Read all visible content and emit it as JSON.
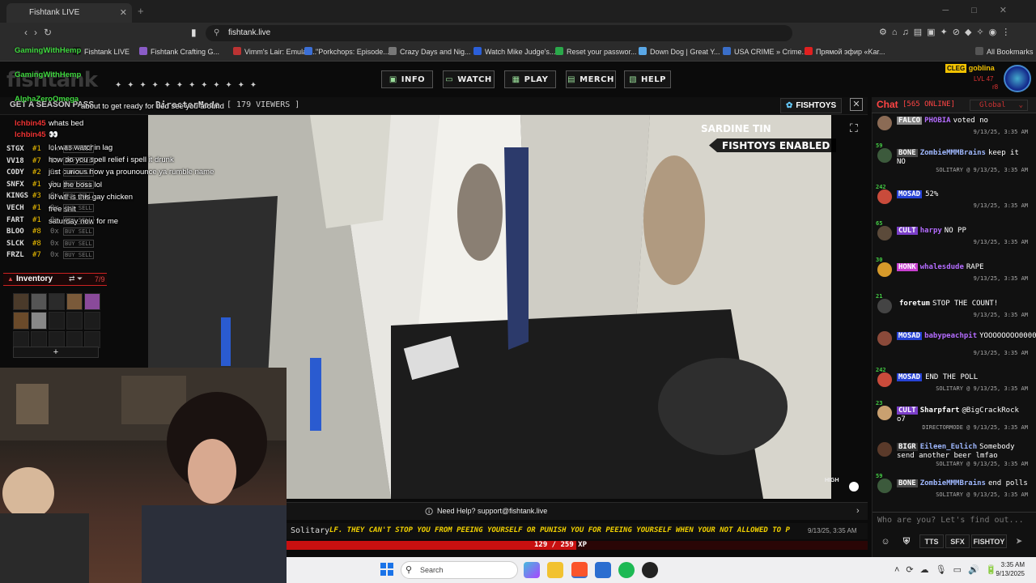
{
  "browser": {
    "tab_title": "Fishtank LIVE",
    "url": "fishtank.live",
    "bookmarks": [
      "Fishtank LIVE",
      "Fishtank Crafting G...",
      "Vimm's Lair: Emulati...",
      "\"Porkchops: Episode...",
      "Crazy Days and Nig...",
      "Watch Mike Judge's...",
      "Reset your passwor...",
      "Down Dog | Great Y...",
      "USA CRIME » Crime...",
      "Прямой эфир «Kar...",
      "All Bookmarks"
    ],
    "bookmark_colors": [
      "#1a1a1a",
      "#8a5cc7",
      "#b33",
      "#3b6fd6",
      "#777",
      "#2b5fd9",
      "#2aa84a",
      "#5aa7e6",
      "#3a6ec8",
      "#e02020",
      "#555"
    ]
  },
  "site": {
    "logo": "fishtank",
    "nav": [
      "INFO",
      "WATCH",
      "PLAY",
      "MERCH",
      "HELP"
    ],
    "nav_icons": [
      "info-icon",
      "tv-icon",
      "gamepad-icon",
      "shop-icon",
      "help-icon"
    ],
    "user": {
      "tag": "CLEG",
      "name": "goblina",
      "level": "LVL 47",
      "hp": "r8"
    },
    "season_pass": "GET A SEASON PASS",
    "director": "DirectorMode",
    "viewers": "[ 179 VIEWERS ]",
    "fishtoys_button": "FISHTOYS",
    "overlay_title": "SARDINE TIN",
    "overlay_status": "FISHTOYS ENABLED",
    "quality": "HIGH"
  },
  "stream_chat": [
    {
      "name": "GamingWithHemp",
      "text": ""
    },
    {
      "name": "GamingWithHemp",
      "text": ""
    },
    {
      "name": "AlphaZeroOmega",
      "text": "about to get ready for bed see you around"
    },
    {
      "name": "lchbin45",
      "text": "whats bed"
    },
    {
      "name": "lchbin45",
      "text": "👀"
    },
    {
      "name": "",
      "text": "lol was watchin lag"
    },
    {
      "name": "",
      "text": "how do you spell relief i spell it drunk"
    },
    {
      "name": "",
      "text": "just curious how ya prounounce ya rumble name"
    },
    {
      "name": "",
      "text": "you the boss lol"
    },
    {
      "name": "",
      "text": "lol wtf is this gay chicken"
    },
    {
      "name": "",
      "text": "free shit"
    },
    {
      "name": "",
      "text": "saturday now for me"
    }
  ],
  "stocks": [
    {
      "sym": "STGX",
      "num": "#1",
      "cnt": "0x"
    },
    {
      "sym": "VV18",
      "num": "#7",
      "cnt": "0x"
    },
    {
      "sym": "CODY",
      "num": "#2",
      "cnt": "0x"
    },
    {
      "sym": "SNFX",
      "num": "#1",
      "cnt": "0x"
    },
    {
      "sym": "KINGS",
      "num": "#3",
      "cnt": "0x"
    },
    {
      "sym": "VECH",
      "num": "#1",
      "cnt": "0x"
    },
    {
      "sym": "FART",
      "num": "#1",
      "cnt": "0x"
    },
    {
      "sym": "BLOO",
      "num": "#8",
      "cnt": "0x"
    },
    {
      "sym": "SLCK",
      "num": "#8",
      "cnt": "0x"
    },
    {
      "sym": "FRZL",
      "num": "#7",
      "cnt": "0x"
    }
  ],
  "buy_sell": "BUY SELL",
  "inventory": {
    "label": "Inventory",
    "count": "7/9",
    "add": "+"
  },
  "help": "Need Help? support@fishtank.live",
  "ticker": {
    "name": "Solitary",
    "text": "LF. THEY CAN'T STOP YOU FROM PEEING YOURSELF OR PUNISH YOU FOR PEEING YOURSELF WHEN YOUR NOT ALLOWED TO P",
    "time": "9/13/25, 3:35 AM"
  },
  "xp": {
    "current": 129,
    "max": 259,
    "label": "129 / 259 XP"
  },
  "chat": {
    "title": "Chat",
    "online": "[565 ONLINE]",
    "channel": "Global",
    "messages": [
      {
        "lvl": "",
        "tag": "FALCO",
        "tagcolor": "#8a8a8a",
        "name": "PHOBIA",
        "namecolor": "#b46cff",
        "text": "voted no",
        "ts": "9/13/25, 3:35 AM",
        "av": "#8b6b55"
      },
      {
        "lvl": "59",
        "tag": "BONE",
        "tagcolor": "#4a4a4a",
        "name": "ZombieMMMBrains",
        "namecolor": "#9fb8ff",
        "text": "keep it NO",
        "ts": "SOLITARY @ 9/13/25, 3:35 AM",
        "av": "#3c5a3c"
      },
      {
        "lvl": "242",
        "tag": "MOSAD",
        "tagcolor": "#2743d6",
        "name": "",
        "namecolor": "#fff",
        "text": "52%",
        "ts": "9/13/25, 3:35 AM",
        "av": "#c94b3b"
      },
      {
        "lvl": "65",
        "tag": "CULT",
        "tagcolor": "#7b3fc9",
        "name": "harpy",
        "namecolor": "#b46cff",
        "text": "NO PP",
        "ts": "9/13/25, 3:35 AM",
        "av": "#5b4a3a"
      },
      {
        "lvl": "30",
        "tag": "HONK",
        "tagcolor": "#c93fd0",
        "name": "whalesdude",
        "namecolor": "#b46cff",
        "text": "RAPE",
        "ts": "9/13/25, 3:35 AM",
        "av": "#d69a2a"
      },
      {
        "lvl": "21",
        "tag": "",
        "tagcolor": "#000",
        "name": "foretum",
        "namecolor": "#fff",
        "text": "STOP THE COUNT!",
        "ts": "9/13/25, 3:35 AM",
        "av": "#444"
      },
      {
        "lvl": "",
        "tag": "MOSAD",
        "tagcolor": "#2743d6",
        "name": "babypeachpit",
        "namecolor": "#b46cff",
        "text": "YOOOOOOOO0000000000",
        "ts": "9/13/25, 3:35 AM",
        "av": "#8b4a3a"
      },
      {
        "lvl": "242",
        "tag": "MOSAD",
        "tagcolor": "#2743d6",
        "name": "",
        "namecolor": "#fff",
        "text": "END THE POLL",
        "ts": "SOLITARY @ 9/13/25, 3:35 AM",
        "av": "#c94b3b"
      },
      {
        "lvl": "23",
        "tag": "CULT",
        "tagcolor": "#7b3fc9",
        "name": "Sharpfart",
        "namecolor": "#fff",
        "text": "@BigCrackRock o7",
        "ts": "DIRECTORMODE @ 9/13/25, 3:35 AM",
        "av": "#c9a070"
      },
      {
        "lvl": "",
        "tag": "BIGR",
        "tagcolor": "#333",
        "name": "Eileen_Eulich",
        "namecolor": "#9fb8ff",
        "text": "Somebody send another beer lmfao",
        "ts": "SOLITARY @ 9/13/25, 3:35 AM",
        "av": "#5a3a2a"
      },
      {
        "lvl": "59",
        "tag": "BONE",
        "tagcolor": "#4a4a4a",
        "name": "ZombieMMMBrains",
        "namecolor": "#9fb8ff",
        "text": "end polls",
        "ts": "SOLITARY @ 9/13/25, 3:35 AM",
        "av": "#3c5a3c"
      }
    ],
    "input_placeholder": "Who are you? Let's find out...",
    "buttons": [
      "TTS",
      "SFX",
      "FISHTOY"
    ]
  },
  "taskbar": {
    "search": "Search",
    "time": "3:35 AM",
    "date": "9/13/2025",
    "apps": [
      "file-explorer-icon",
      "brave-icon",
      "notepad-icon",
      "spotify-icon",
      "obs-icon"
    ]
  }
}
